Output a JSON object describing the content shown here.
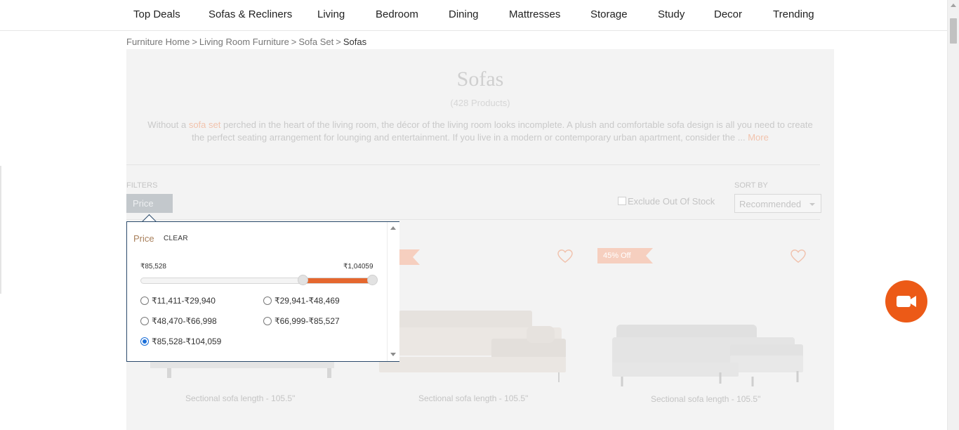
{
  "nav": {
    "items": [
      "Top Deals",
      "Sofas & Recliners",
      "Living",
      "Bedroom",
      "Dining",
      "Mattresses",
      "Storage",
      "Study",
      "Decor",
      "Trending"
    ]
  },
  "breadcrumb": {
    "items": [
      "Furniture Home",
      "Living Room Furniture",
      "Sofa Set"
    ],
    "separator": ">",
    "current": "Sofas"
  },
  "category": {
    "title": "Sofas",
    "count": "(428 Products)",
    "desc_prefix": "Without a ",
    "desc_link": "sofa set",
    "desc_line1_rest": " perched in the heart of the living room, the décor of the living room looks incomplete. A plush and comfortable sofa design is all you need to create",
    "desc_line2": "the perfect seating arrangement for lounging and entertainment. If you live in a modern or contemporary urban apartment, consider the ...",
    "more": "More"
  },
  "filters": {
    "label": "FILTERS",
    "price_tab": "Price",
    "exclude_label": "Exclude Out Of Stock",
    "sort_label": "SORT BY",
    "sort_value": "Recommended"
  },
  "price_popup": {
    "title": "Price",
    "clear": "CLEAR",
    "min_label": "₹85,528",
    "max_label": "₹1,04059",
    "range_selected": [
      0.7,
      1.0
    ],
    "options": [
      {
        "label": "₹11,411-₹29,940",
        "checked": false
      },
      {
        "label": "₹29,941-₹48,469",
        "checked": false
      },
      {
        "label": "₹48,470-₹66,998",
        "checked": false
      },
      {
        "label": "₹66,999-₹85,527",
        "checked": false
      },
      {
        "label": "₹85,528-₹104,059",
        "checked": true
      }
    ]
  },
  "products": [
    {
      "caption": "Sectional sofa length - 105.5\""
    },
    {
      "caption": "Sectional sofa length - 105.5\""
    },
    {
      "caption": "Sectional sofa length - 105.5\"",
      "badge": "45% Off"
    }
  ],
  "colors": {
    "accent": "#e5672e",
    "fab": "#ec5a17",
    "popup_border": "#2b4a6b"
  },
  "icons": {
    "fab": "video-camera-icon",
    "wishlist": "heart-icon"
  }
}
